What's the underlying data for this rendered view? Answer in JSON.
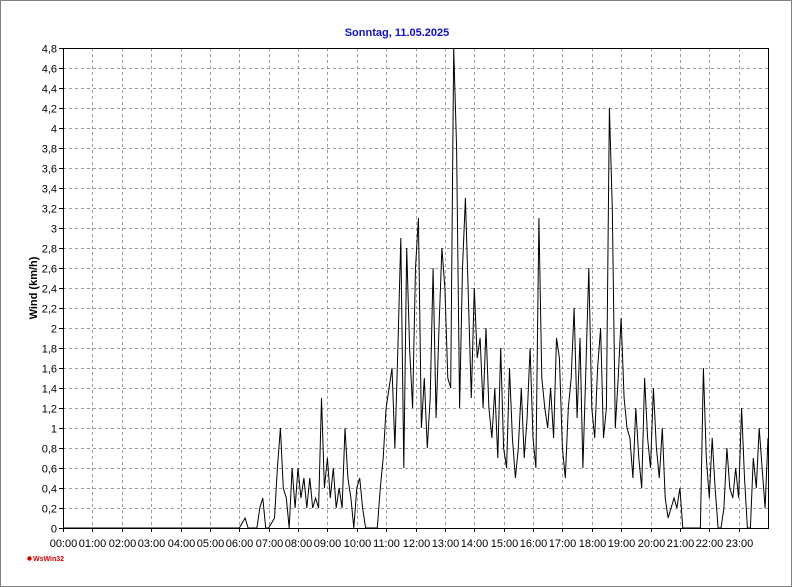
{
  "chart_data": {
    "type": "line",
    "title": "Sonntag, 11.05.2025",
    "xlabel": "",
    "ylabel": "Wind  (km/h)",
    "x_ticks": [
      "00:00",
      "01:00",
      "02:00",
      "03:00",
      "04:00",
      "05:00",
      "06:00",
      "07:00",
      "08:00",
      "09:00",
      "10:00",
      "11:00",
      "12:00",
      "13:00",
      "14:00",
      "15:00",
      "16:00",
      "17:00",
      "18:00",
      "19:00",
      "20:00",
      "21:00",
      "22:00",
      "23:00"
    ],
    "y_ticks": [
      "0",
      "0,2",
      "0,4",
      "0,6",
      "0,8",
      "1",
      "1,2",
      "1,4",
      "1,6",
      "1,8",
      "2",
      "2,2",
      "2,4",
      "2,6",
      "2,8",
      "3",
      "3,2",
      "3,4",
      "3,6",
      "3,8",
      "4",
      "4,2",
      "4,4",
      "4,6",
      "4,8"
    ],
    "xlim_hours": [
      0,
      24
    ],
    "ylim": [
      0,
      4.8
    ],
    "grid": true,
    "colors": {
      "line": "#000000",
      "grid": "#9a9a9a",
      "title": "#1010c8"
    },
    "series": [
      {
        "x_hours": [
          0,
          6.0,
          6.2,
          6.3,
          6.4,
          6.6,
          6.7,
          6.8,
          6.9,
          7.0,
          7.2,
          7.3,
          7.4,
          7.5,
          7.6,
          7.7,
          7.8,
          7.9,
          8.0,
          8.1,
          8.2,
          8.3,
          8.4,
          8.5,
          8.6,
          8.7,
          8.8,
          8.9,
          9.0,
          9.1,
          9.2,
          9.3,
          9.4,
          9.5,
          9.6,
          9.7,
          9.8,
          9.9,
          10.0,
          10.1,
          10.2,
          10.3,
          10.4,
          10.5,
          10.6,
          10.7,
          10.8,
          10.9,
          11.0,
          11.1,
          11.2,
          11.3,
          11.4,
          11.5,
          11.6,
          11.7,
          11.8,
          11.9,
          12.0,
          12.1,
          12.2,
          12.3,
          12.4,
          12.5,
          12.6,
          12.7,
          12.8,
          12.9,
          13.0,
          13.1,
          13.2,
          13.3,
          13.4,
          13.5,
          13.6,
          13.7,
          13.8,
          13.9,
          14.0,
          14.1,
          14.2,
          14.3,
          14.4,
          14.5,
          14.6,
          14.7,
          14.8,
          14.9,
          15.0,
          15.1,
          15.2,
          15.3,
          15.4,
          15.5,
          15.6,
          15.7,
          15.8,
          15.9,
          16.0,
          16.1,
          16.2,
          16.3,
          16.4,
          16.5,
          16.6,
          16.7,
          16.8,
          16.9,
          17.0,
          17.1,
          17.2,
          17.3,
          17.4,
          17.5,
          17.6,
          17.7,
          17.8,
          17.9,
          18.0,
          18.1,
          18.2,
          18.3,
          18.4,
          18.5,
          18.6,
          18.7,
          18.8,
          18.9,
          19.0,
          19.1,
          19.2,
          19.3,
          19.4,
          19.5,
          19.6,
          19.7,
          19.8,
          19.9,
          20.0,
          20.1,
          20.2,
          20.3,
          20.4,
          20.5,
          20.6,
          20.7,
          20.8,
          20.9,
          21.0,
          21.1,
          21.2,
          21.3,
          21.4,
          21.5,
          21.6,
          21.7,
          21.8,
          21.9,
          22.0,
          22.1,
          22.2,
          22.3,
          22.4,
          22.5,
          22.6,
          22.7,
          22.8,
          22.9,
          23.0,
          23.1,
          23.2,
          23.3,
          23.4,
          23.5,
          23.6,
          23.7,
          23.8,
          23.9,
          24.0
        ],
        "values": [
          0,
          0,
          0.1,
          0,
          0,
          0,
          0.2,
          0.3,
          0,
          0,
          0.1,
          0.6,
          1.0,
          0.4,
          0.3,
          0,
          0.6,
          0.2,
          0.6,
          0.3,
          0.5,
          0.2,
          0.5,
          0.2,
          0.3,
          0.2,
          1.3,
          0.4,
          0.7,
          0.3,
          0.6,
          0.2,
          0.4,
          0.2,
          1.0,
          0.5,
          0.3,
          0,
          0.4,
          0.5,
          0.2,
          0,
          0,
          0,
          0,
          0,
          0.4,
          0.7,
          1.2,
          1.4,
          1.6,
          0.8,
          1.8,
          2.9,
          0.6,
          2.8,
          1.8,
          1.2,
          2.6,
          3.1,
          1.0,
          1.5,
          0.8,
          1.3,
          2.6,
          1.1,
          2.0,
          2.8,
          2.4,
          1.5,
          1.4,
          4.8,
          3.8,
          1.2,
          2.6,
          3.3,
          2.3,
          1.3,
          2.4,
          1.7,
          1.9,
          1.2,
          2.0,
          1.2,
          0.9,
          1.4,
          0.7,
          1.8,
          0.8,
          0.6,
          1.6,
          0.9,
          0.5,
          0.8,
          1.4,
          0.7,
          1.1,
          1.8,
          0.9,
          0.6,
          3.1,
          1.5,
          1.2,
          1.0,
          1.4,
          0.9,
          1.9,
          1.7,
          0.8,
          0.5,
          1.2,
          1.5,
          2.2,
          1.1,
          1.9,
          0.6,
          1.6,
          2.6,
          1.2,
          0.9,
          1.6,
          2.0,
          0.9,
          1.2,
          4.2,
          3.2,
          1.0,
          1.5,
          2.1,
          1.3,
          1.0,
          0.9,
          0.5,
          1.2,
          0.7,
          0.4,
          1.5,
          0.9,
          0.6,
          1.4,
          0.8,
          0.5,
          1.0,
          0.3,
          0.1,
          0.2,
          0.3,
          0.2,
          0.4,
          0,
          0,
          0,
          0,
          0,
          0,
          0,
          1.6,
          0.7,
          0.3,
          0.9,
          0.4,
          0,
          0,
          0.2,
          0.8,
          0.4,
          0.3,
          0.6,
          0.3,
          1.2,
          0.5,
          0,
          0,
          0.7,
          0.4,
          1.0,
          0.6,
          0.2,
          0.9,
          0.5
        ]
      }
    ]
  },
  "branding": {
    "logo_text": "WsWin32"
  }
}
